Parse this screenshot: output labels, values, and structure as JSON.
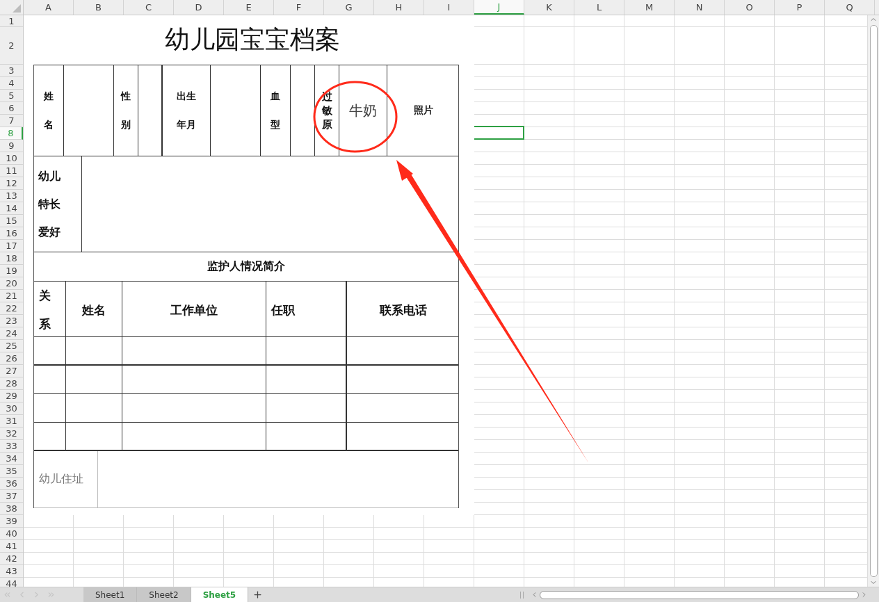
{
  "columns": [
    {
      "label": "A",
      "selected": false
    },
    {
      "label": "B",
      "selected": false
    },
    {
      "label": "C",
      "selected": false
    },
    {
      "label": "D",
      "selected": false
    },
    {
      "label": "E",
      "selected": false
    },
    {
      "label": "F",
      "selected": false
    },
    {
      "label": "G",
      "selected": false
    },
    {
      "label": "H",
      "selected": false
    },
    {
      "label": "I",
      "selected": false
    },
    {
      "label": "J",
      "selected": true
    },
    {
      "label": "K",
      "selected": false
    },
    {
      "label": "L",
      "selected": false
    },
    {
      "label": "M",
      "selected": false
    },
    {
      "label": "N",
      "selected": false
    },
    {
      "label": "O",
      "selected": false
    },
    {
      "label": "P",
      "selected": false
    },
    {
      "label": "Q",
      "selected": false
    }
  ],
  "rows": [
    {
      "label": "1",
      "selected": false
    },
    {
      "label": "2",
      "selected": false
    },
    {
      "label": "3",
      "selected": false
    },
    {
      "label": "4",
      "selected": false
    },
    {
      "label": "5",
      "selected": false
    },
    {
      "label": "6",
      "selected": false
    },
    {
      "label": "7",
      "selected": false
    },
    {
      "label": "8",
      "selected": true
    },
    {
      "label": "9",
      "selected": false
    },
    {
      "label": "10",
      "selected": false
    },
    {
      "label": "11",
      "selected": false
    },
    {
      "label": "12",
      "selected": false
    },
    {
      "label": "13",
      "selected": false
    },
    {
      "label": "14",
      "selected": false
    },
    {
      "label": "15",
      "selected": false
    },
    {
      "label": "16",
      "selected": false
    },
    {
      "label": "17",
      "selected": false
    },
    {
      "label": "18",
      "selected": false
    },
    {
      "label": "19",
      "selected": false
    },
    {
      "label": "20",
      "selected": false
    },
    {
      "label": "21",
      "selected": false
    },
    {
      "label": "22",
      "selected": false
    },
    {
      "label": "23",
      "selected": false
    },
    {
      "label": "24",
      "selected": false
    },
    {
      "label": "25",
      "selected": false
    },
    {
      "label": "26",
      "selected": false
    },
    {
      "label": "27",
      "selected": false
    },
    {
      "label": "28",
      "selected": false
    },
    {
      "label": "29",
      "selected": false
    },
    {
      "label": "30",
      "selected": false
    },
    {
      "label": "31",
      "selected": false
    },
    {
      "label": "32",
      "selected": false
    },
    {
      "label": "33",
      "selected": false
    },
    {
      "label": "34",
      "selected": false
    },
    {
      "label": "35",
      "selected": false
    },
    {
      "label": "36",
      "selected": false
    },
    {
      "label": "37",
      "selected": false
    },
    {
      "label": "38",
      "selected": false
    },
    {
      "label": "39",
      "selected": false
    },
    {
      "label": "40",
      "selected": false
    },
    {
      "label": "41",
      "selected": false
    },
    {
      "label": "42",
      "selected": false
    },
    {
      "label": "43",
      "selected": false
    },
    {
      "label": "44",
      "selected": false
    }
  ],
  "form": {
    "title": "幼儿园宝宝档案",
    "profile_cells": [
      {
        "kind": "label",
        "text": "姓名"
      },
      {
        "kind": "blank"
      },
      {
        "kind": "label",
        "text": "性别"
      },
      {
        "kind": "blank"
      },
      {
        "kind": "label-pair",
        "text": "出生年月"
      },
      {
        "kind": "blank"
      },
      {
        "kind": "label",
        "text": "血型"
      },
      {
        "kind": "blank"
      },
      {
        "kind": "label-tight",
        "text": "过敏原"
      },
      {
        "kind": "value",
        "text": "牛奶"
      },
      {
        "kind": "photo",
        "text": "照片"
      }
    ],
    "hobbies_label": "幼儿特长爱好",
    "guardian_heading": "监护人情况简介",
    "guardian_columns": [
      {
        "label": "关系",
        "kind": "vertical"
      },
      {
        "label": "姓名",
        "kind": "center"
      },
      {
        "label": "工作单位",
        "kind": "center"
      },
      {
        "label": "任职",
        "kind": "left"
      },
      {
        "label": "联系电话",
        "kind": "center"
      }
    ],
    "address_label": "幼儿住址"
  },
  "sheet_tabs": [
    {
      "label": "Sheet1",
      "selected": false
    },
    {
      "label": "Sheet2",
      "selected": false
    },
    {
      "label": "Sheet5",
      "selected": true
    }
  ]
}
